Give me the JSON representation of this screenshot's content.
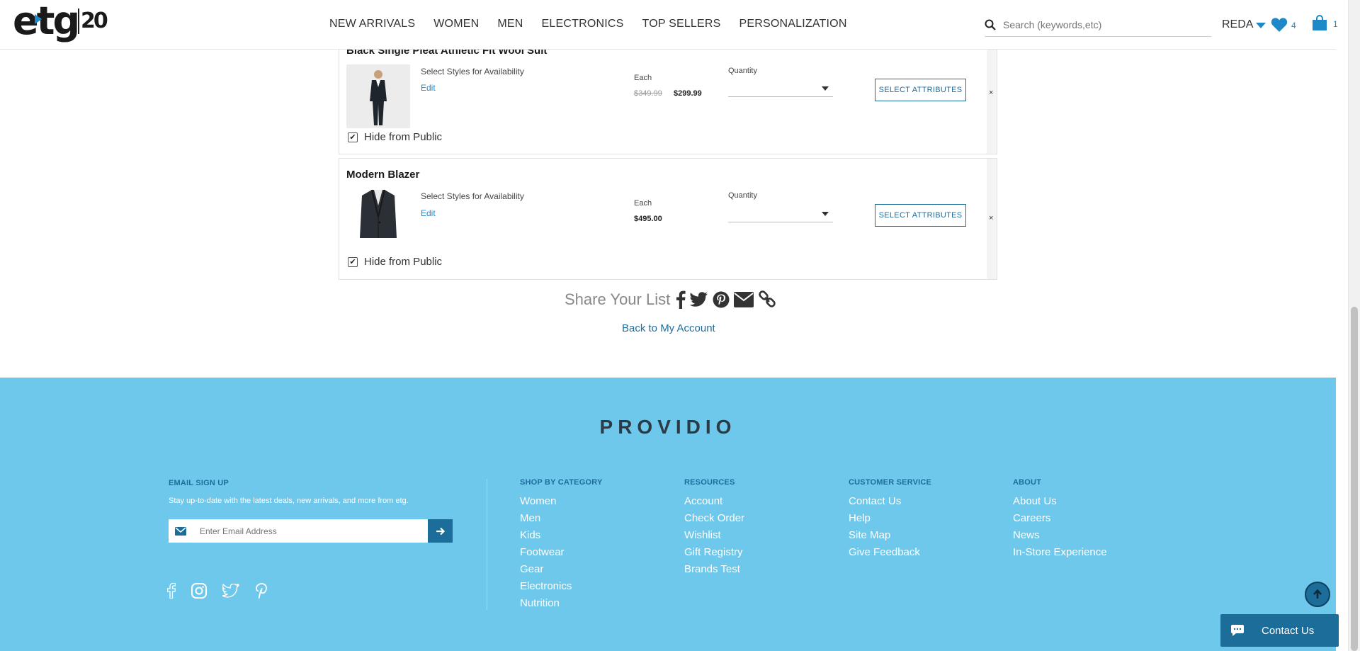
{
  "header": {
    "logo_text": "etg",
    "logo_badge": "20",
    "nav": [
      "NEW ARRIVALS",
      "WOMEN",
      "MEN",
      "ELECTRONICS",
      "TOP SELLERS",
      "PERSONALIZATION"
    ],
    "search_placeholder": "Search (keywords,etc)",
    "user": "REDA",
    "wishlist_count": "4",
    "cart_count": "1"
  },
  "items": [
    {
      "title": "Black Single Pleat Athletic Fit Wool Suit",
      "styles_label": "Select Styles for Availability",
      "edit_label": "Edit",
      "each_label": "Each",
      "original_price": "$349.99",
      "price": "$299.99",
      "qty_label": "Quantity",
      "button": "SELECT ATTRIBUTES",
      "remove": "×",
      "hide_label": "Hide from Public",
      "hidden": true
    },
    {
      "title": "Modern Blazer",
      "styles_label": "Select Styles for Availability",
      "edit_label": "Edit",
      "each_label": "Each",
      "price": "$495.00",
      "qty_label": "Quantity",
      "button": "SELECT ATTRIBUTES",
      "remove": "×",
      "hide_label": "Hide from Public",
      "hidden": true
    }
  ],
  "share": {
    "label": "Share Your List",
    "icons": [
      "facebook-icon",
      "twitter-icon",
      "pinterest-icon",
      "email-icon",
      "link-icon"
    ]
  },
  "back_link": "Back to My Account",
  "footer": {
    "brand": "PROVIDIO",
    "signup_heading": "EMAIL SIGN UP",
    "signup_text": "Stay up-to-date with the latest deals, new arrivals, and more from etg.",
    "email_placeholder": "Enter Email Address",
    "columns": [
      {
        "heading": "SHOP BY CATEGORY",
        "links": [
          "Women",
          "Men",
          "Kids",
          "Footwear",
          "Gear",
          "Electronics",
          "Nutrition"
        ]
      },
      {
        "heading": "RESOURCES",
        "links": [
          "Account",
          "Check Order",
          "Wishlist",
          "Gift Registry",
          "Brands Test"
        ]
      },
      {
        "heading": "CUSTOMER SERVICE",
        "links": [
          "Contact Us",
          "Help",
          "Site Map",
          "Give Feedback"
        ]
      },
      {
        "heading": "ABOUT",
        "links": [
          "About Us",
          "Careers",
          "News",
          "In-Store Experience"
        ]
      }
    ],
    "contact_button": "Contact Us"
  },
  "colors": {
    "accent": "#1e88c8",
    "footer_bg": "#6dc8ec",
    "footer_heading": "#1c6d9a"
  }
}
